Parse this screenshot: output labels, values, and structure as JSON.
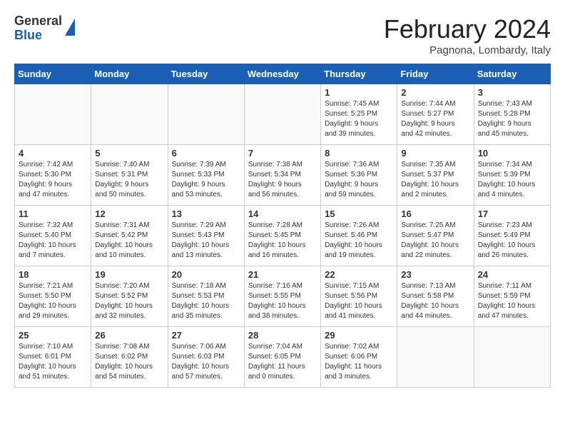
{
  "header": {
    "logo_general": "General",
    "logo_blue": "Blue",
    "month_year": "February 2024",
    "location": "Pagnona, Lombardy, Italy"
  },
  "weekdays": [
    "Sunday",
    "Monday",
    "Tuesday",
    "Wednesday",
    "Thursday",
    "Friday",
    "Saturday"
  ],
  "weeks": [
    [
      {
        "day": "",
        "info": ""
      },
      {
        "day": "",
        "info": ""
      },
      {
        "day": "",
        "info": ""
      },
      {
        "day": "",
        "info": ""
      },
      {
        "day": "1",
        "info": "Sunrise: 7:45 AM\nSunset: 5:25 PM\nDaylight: 9 hours\nand 39 minutes."
      },
      {
        "day": "2",
        "info": "Sunrise: 7:44 AM\nSunset: 5:27 PM\nDaylight: 9 hours\nand 42 minutes."
      },
      {
        "day": "3",
        "info": "Sunrise: 7:43 AM\nSunset: 5:28 PM\nDaylight: 9 hours\nand 45 minutes."
      }
    ],
    [
      {
        "day": "4",
        "info": "Sunrise: 7:42 AM\nSunset: 5:30 PM\nDaylight: 9 hours\nand 47 minutes."
      },
      {
        "day": "5",
        "info": "Sunrise: 7:40 AM\nSunset: 5:31 PM\nDaylight: 9 hours\nand 50 minutes."
      },
      {
        "day": "6",
        "info": "Sunrise: 7:39 AM\nSunset: 5:33 PM\nDaylight: 9 hours\nand 53 minutes."
      },
      {
        "day": "7",
        "info": "Sunrise: 7:38 AM\nSunset: 5:34 PM\nDaylight: 9 hours\nand 56 minutes."
      },
      {
        "day": "8",
        "info": "Sunrise: 7:36 AM\nSunset: 5:36 PM\nDaylight: 9 hours\nand 59 minutes."
      },
      {
        "day": "9",
        "info": "Sunrise: 7:35 AM\nSunset: 5:37 PM\nDaylight: 10 hours\nand 2 minutes."
      },
      {
        "day": "10",
        "info": "Sunrise: 7:34 AM\nSunset: 5:39 PM\nDaylight: 10 hours\nand 4 minutes."
      }
    ],
    [
      {
        "day": "11",
        "info": "Sunrise: 7:32 AM\nSunset: 5:40 PM\nDaylight: 10 hours\nand 7 minutes."
      },
      {
        "day": "12",
        "info": "Sunrise: 7:31 AM\nSunset: 5:42 PM\nDaylight: 10 hours\nand 10 minutes."
      },
      {
        "day": "13",
        "info": "Sunrise: 7:29 AM\nSunset: 5:43 PM\nDaylight: 10 hours\nand 13 minutes."
      },
      {
        "day": "14",
        "info": "Sunrise: 7:28 AM\nSunset: 5:45 PM\nDaylight: 10 hours\nand 16 minutes."
      },
      {
        "day": "15",
        "info": "Sunrise: 7:26 AM\nSunset: 5:46 PM\nDaylight: 10 hours\nand 19 minutes."
      },
      {
        "day": "16",
        "info": "Sunrise: 7:25 AM\nSunset: 5:47 PM\nDaylight: 10 hours\nand 22 minutes."
      },
      {
        "day": "17",
        "info": "Sunrise: 7:23 AM\nSunset: 5:49 PM\nDaylight: 10 hours\nand 26 minutes."
      }
    ],
    [
      {
        "day": "18",
        "info": "Sunrise: 7:21 AM\nSunset: 5:50 PM\nDaylight: 10 hours\nand 29 minutes."
      },
      {
        "day": "19",
        "info": "Sunrise: 7:20 AM\nSunset: 5:52 PM\nDaylight: 10 hours\nand 32 minutes."
      },
      {
        "day": "20",
        "info": "Sunrise: 7:18 AM\nSunset: 5:53 PM\nDaylight: 10 hours\nand 35 minutes."
      },
      {
        "day": "21",
        "info": "Sunrise: 7:16 AM\nSunset: 5:55 PM\nDaylight: 10 hours\nand 38 minutes."
      },
      {
        "day": "22",
        "info": "Sunrise: 7:15 AM\nSunset: 5:56 PM\nDaylight: 10 hours\nand 41 minutes."
      },
      {
        "day": "23",
        "info": "Sunrise: 7:13 AM\nSunset: 5:58 PM\nDaylight: 10 hours\nand 44 minutes."
      },
      {
        "day": "24",
        "info": "Sunrise: 7:11 AM\nSunset: 5:59 PM\nDaylight: 10 hours\nand 47 minutes."
      }
    ],
    [
      {
        "day": "25",
        "info": "Sunrise: 7:10 AM\nSunset: 6:01 PM\nDaylight: 10 hours\nand 51 minutes."
      },
      {
        "day": "26",
        "info": "Sunrise: 7:08 AM\nSunset: 6:02 PM\nDaylight: 10 hours\nand 54 minutes."
      },
      {
        "day": "27",
        "info": "Sunrise: 7:06 AM\nSunset: 6:03 PM\nDaylight: 10 hours\nand 57 minutes."
      },
      {
        "day": "28",
        "info": "Sunrise: 7:04 AM\nSunset: 6:05 PM\nDaylight: 11 hours\nand 0 minutes."
      },
      {
        "day": "29",
        "info": "Sunrise: 7:02 AM\nSunset: 6:06 PM\nDaylight: 11 hours\nand 3 minutes."
      },
      {
        "day": "",
        "info": ""
      },
      {
        "day": "",
        "info": ""
      }
    ]
  ]
}
